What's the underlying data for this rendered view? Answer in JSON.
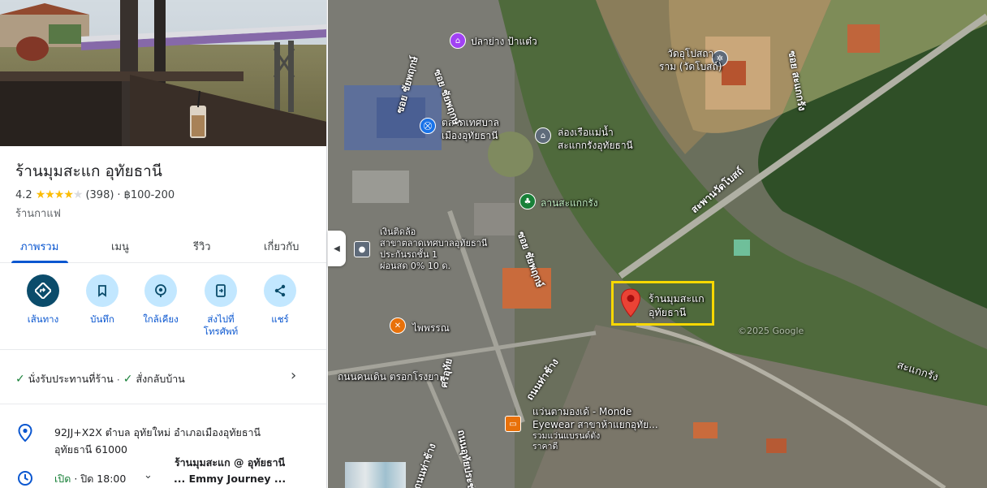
{
  "place": {
    "name": "ร้านมุมสะแก อุทัยธานี",
    "rating": "4.2",
    "stars": "★★★★",
    "star_empty": "★",
    "reviews": "(398)",
    "price": "฿100-200",
    "category": "ร้านกาแฟ"
  },
  "tabs": [
    "ภาพรวม",
    "เมนู",
    "รีวิว",
    "เกี่ยวกับ"
  ],
  "actions": [
    {
      "label": "เส้นทาง",
      "icon": "directions-icon"
    },
    {
      "label": "บันทึก",
      "icon": "bookmark-icon"
    },
    {
      "label": "ใกล้เคียง",
      "icon": "nearby-icon"
    },
    {
      "label": "ส่งไปที่\nโทรศัพท์",
      "icon": "send-to-phone-icon"
    },
    {
      "label": "แชร์",
      "icon": "share-icon"
    }
  ],
  "services": {
    "dine_in": "นั่งรับประทานที่ร้าน",
    "takeout": "สั่งกลับบ้าน",
    "check": "✓",
    "sep": "·"
  },
  "address": {
    "line1": "92JJ+X2X ตำบล อุทัยใหม่ อำเภอเมืองอุทัยธานี",
    "line2": "อุทัยธานี 61000"
  },
  "hours": {
    "status": "เปิด",
    "sep": "·",
    "detail": "ปิด 18:00"
  },
  "overlay_caption": {
    "line1": "ร้านมุมสะแก @ อุทัยธานี",
    "line2": "... Emmy Journey ..."
  },
  "map": {
    "labels": {
      "pla_yang": "ปลาย่าง ป้าแต๋ว",
      "wat_1": "วัดอุโปสถา",
      "wat_2": "ราม (วัดโบสถ์)",
      "market_1": "ตลาดเทศบาล",
      "market_2": "เมืองอุทัยธานี",
      "boat_1": "ล่องเรือแม่น้ำ",
      "boat_2": "สะแกกรังอุทัยธานี",
      "lan": "ลานสะแกกรัง",
      "atm_1": "เงินติดล้อ",
      "atm_2": "สาขาตลาดเทศบาลอุทัยธานี",
      "atm_3": "ประกันรถชั้น 1",
      "atm_4": "ผ่อนสด 0% 10 ด.",
      "phaiphan": "ไพพรรณ",
      "walking_st": "ถนนคนเดิน ตรอกโรงยา",
      "monde_1": "แว่นตามองเด้ - Monde",
      "monde_2": "Eyewear สาขาห้าแยกอุทัย...",
      "monde_3": "รวมแว่นแบรนด์ดัง",
      "monde_4": "ราคาดี",
      "river": "สะแกกรัง",
      "watermark": "©2025 Google"
    },
    "roads": {
      "soi_chaiyaphruek_1": "ซอย ชัยพฤกษ์",
      "soi_chaiyaphruek_2": "ซอย ชัยพฤกษ์",
      "soi_chaiyaphruek_3": "ซอย ชัยพฤกษ์",
      "soi_sakaekrang": "ซอย สะแกกรัง",
      "saphan": "สะพานวัดโบสถ์",
      "sriuthai": "ศรีอุทัย",
      "thatachang_1": "ถนนท่าช้าง",
      "thatachang_2": "ถนนท่าช้าง",
      "uthai_prapha": "ถนนอุทัยประชา"
    },
    "selected": {
      "line1": "ร้านมุมสะแก",
      "line2": "อุทัยธานี"
    },
    "collapse_icon": "◀"
  }
}
